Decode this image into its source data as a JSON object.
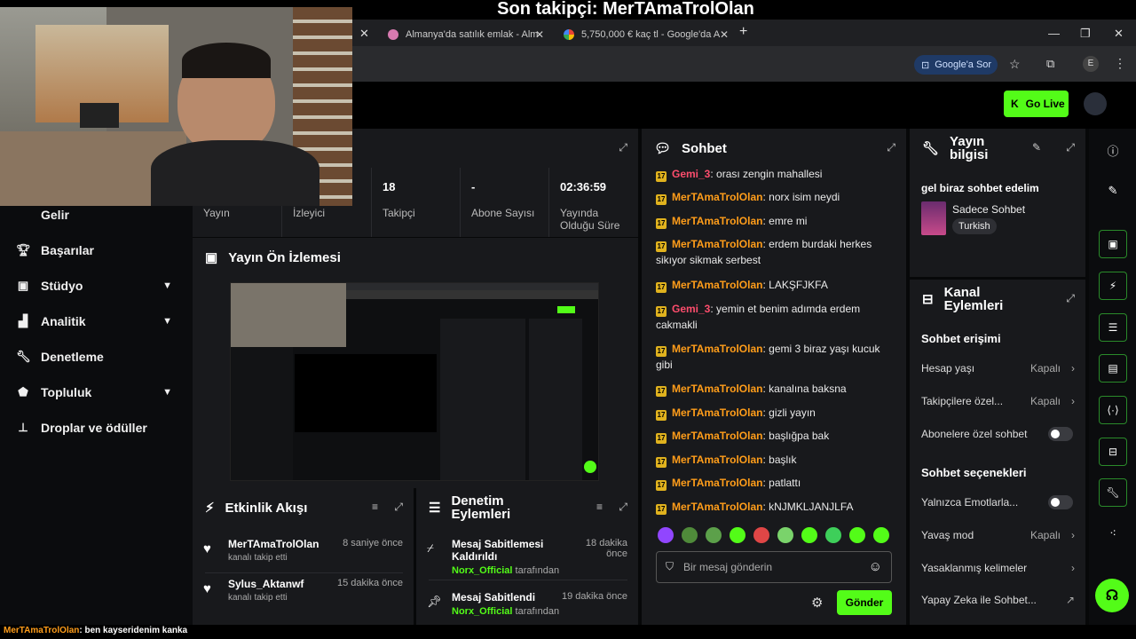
{
  "banner": {
    "title": "Son takipçi: MerTAmaTrolOlan"
  },
  "browser": {
    "tabs": [
      {
        "label": "Almanya'da satılık emlak - Alm"
      },
      {
        "label": "5,750,000 € kaç tl - Google'da A"
      }
    ],
    "new_tab": "+",
    "google_pill": "Google'a Sor",
    "profile_initial": "E"
  },
  "appbar": {
    "go_live": "Go Live"
  },
  "sidebar": {
    "items": [
      {
        "label": "Gelir"
      },
      {
        "label": "Başarılar"
      },
      {
        "label": "Stüdyo"
      },
      {
        "label": "Analitik"
      },
      {
        "label": "Denetleme"
      },
      {
        "label": "Topluluk"
      },
      {
        "label": "Droplar ve ödüller"
      }
    ]
  },
  "stats": {
    "items": [
      {
        "value": "",
        "label": "Yayın"
      },
      {
        "value": "",
        "label": "İzleyici"
      },
      {
        "value": "18",
        "label": "Takipçi"
      },
      {
        "value": "-",
        "label": "Abone Sayısı"
      },
      {
        "value": "02:36:59",
        "label": "Yayında Olduğu Süre"
      }
    ]
  },
  "preview": {
    "title": "Yayın Ön İzlemesi"
  },
  "activity": {
    "title": "Etkinlik Akışı",
    "items": [
      {
        "name": "MerTAmaTrolOlan",
        "sub": "kanalı takip etti",
        "time": "8 saniye önce"
      },
      {
        "name": "Sylus_Aktanwf",
        "sub": "kanalı takip etti",
        "time": "15 dakika önce"
      }
    ]
  },
  "moderation": {
    "title": "Denetim Eylemleri",
    "items": [
      {
        "action": "Mesaj Sabitlemesi Kaldırıldı",
        "by": "Norx_Official",
        "by_suffix": "tarafından",
        "time": "18 dakika önce"
      },
      {
        "action": "Mesaj Sabitlendi",
        "by": "Norx_Official",
        "by_suffix": "tarafından",
        "time": "19 dakika önce"
      }
    ]
  },
  "chat": {
    "title": "Sohbet",
    "badge": "17",
    "messages": [
      {
        "user": "Gemi_3",
        "color": "#ff4d6d",
        "text": "orası zengin mahallesi"
      },
      {
        "user": "MerTAmaTrolOlan",
        "color": "#ff9d1a",
        "text": "norx isim neydi"
      },
      {
        "user": "MerTAmaTrolOlan",
        "color": "#ff9d1a",
        "text": "emre mi"
      },
      {
        "user": "MerTAmaTrolOlan",
        "color": "#ff9d1a",
        "text": "erdem burdaki herkes sikıyor sikmak serbest"
      },
      {
        "user": "MerTAmaTrolOlan",
        "color": "#ff9d1a",
        "text": "LAKŞFJKFA"
      },
      {
        "user": "Gemi_3",
        "color": "#ff4d6d",
        "text": "yemin et benim adımda erdem cakmakli"
      },
      {
        "user": "MerTAmaTrolOlan",
        "color": "#ff9d1a",
        "text": "gemi 3 biraz yaşı kucuk gibi"
      },
      {
        "user": "MerTAmaTrolOlan",
        "color": "#ff9d1a",
        "text": "kanalına baksna"
      },
      {
        "user": "MerTAmaTrolOlan",
        "color": "#ff9d1a",
        "text": "gizli yayın"
      },
      {
        "user": "MerTAmaTrolOlan",
        "color": "#ff9d1a",
        "text": "başlığpa bak"
      },
      {
        "user": "MerTAmaTrolOlan",
        "color": "#ff9d1a",
        "text": "başlık"
      },
      {
        "user": "MerTAmaTrolOlan",
        "color": "#ff9d1a",
        "text": "patlattı"
      },
      {
        "user": "MerTAmaTrolOlan",
        "color": "#ff9d1a",
        "text": "kNJMKLJANJLFA"
      }
    ],
    "input_placeholder": "Bir mesaj gönderin",
    "send": "Gönder"
  },
  "stream_info": {
    "title": "Yayın bilgisi",
    "stream_title": "gel biraz sohbet edelim",
    "category": "Sadece Sohbet",
    "language": "Turkish"
  },
  "channel_actions": {
    "title": "Kanal Eylemleri",
    "chat_access": "Sohbet erişimi",
    "account_age": "Hesap yaşı",
    "account_age_val": "Kapalı",
    "followers_only": "Takipçilere özel...",
    "followers_only_val": "Kapalı",
    "subs_only": "Abonelere özel sohbet",
    "chat_options": "Sohbet seçenekleri",
    "emotes_only": "Yalnızca Emotlarla...",
    "slow_mode": "Yavaş mod",
    "slow_mode_val": "Kapalı",
    "banned_words": "Yasaklanmış kelimeler",
    "ai_chat": "Yapay Zeka ile Sohbet..."
  },
  "caption": {
    "user": "MerTAmaTrolOlan",
    "text": ": ben kayseridenim kanka"
  }
}
